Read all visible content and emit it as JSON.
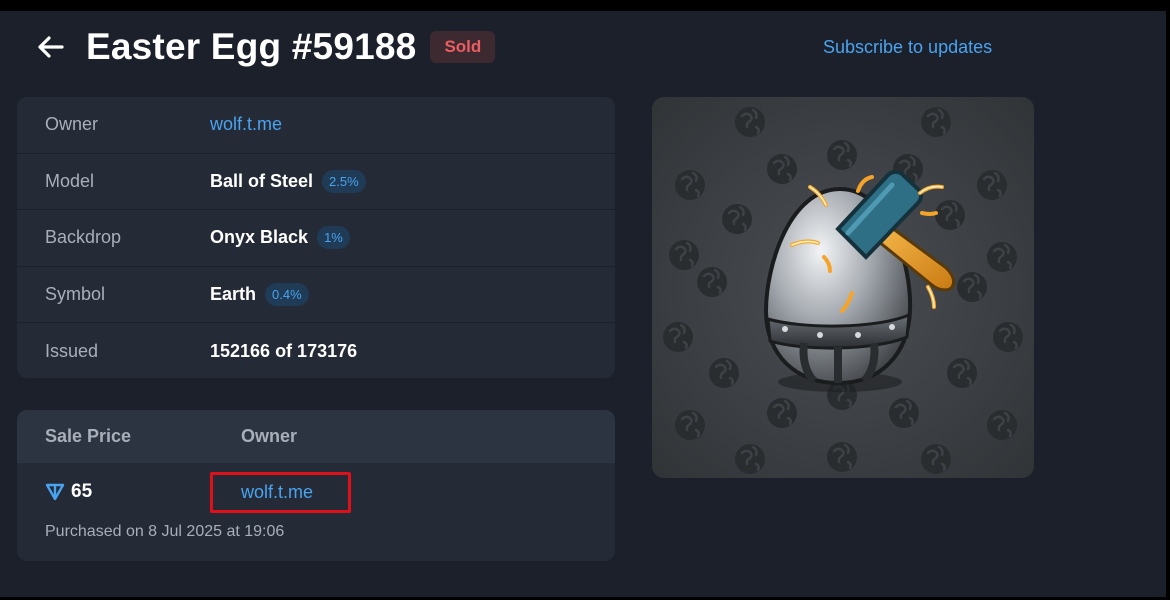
{
  "header": {
    "title": "Easter Egg #59188",
    "status_badge": "Sold",
    "subscribe_label": "Subscribe to updates"
  },
  "info": {
    "rows": [
      {
        "label": "Owner",
        "value": "wolf.t.me"
      },
      {
        "label": "Model",
        "value": "Ball of Steel",
        "percent": "2.5%"
      },
      {
        "label": "Backdrop",
        "value": "Onyx Black",
        "percent": "1%"
      },
      {
        "label": "Symbol",
        "value": "Earth",
        "percent": "0.4%"
      },
      {
        "label": "Issued",
        "value": "152166 of 173176"
      }
    ]
  },
  "sale": {
    "price_header": "Sale Price",
    "owner_header": "Owner",
    "price": "65",
    "owner": "wolf.t.me",
    "purchased": "Purchased on 8 Jul 2025 at 19:06"
  },
  "icons": {
    "back": "arrow-left-icon",
    "currency": "ton-icon"
  },
  "colors": {
    "background": "#1b202a",
    "card": "#242b36",
    "link": "#4aa3f0",
    "sold": "#ec5d62",
    "highlight": "#e0101a"
  }
}
